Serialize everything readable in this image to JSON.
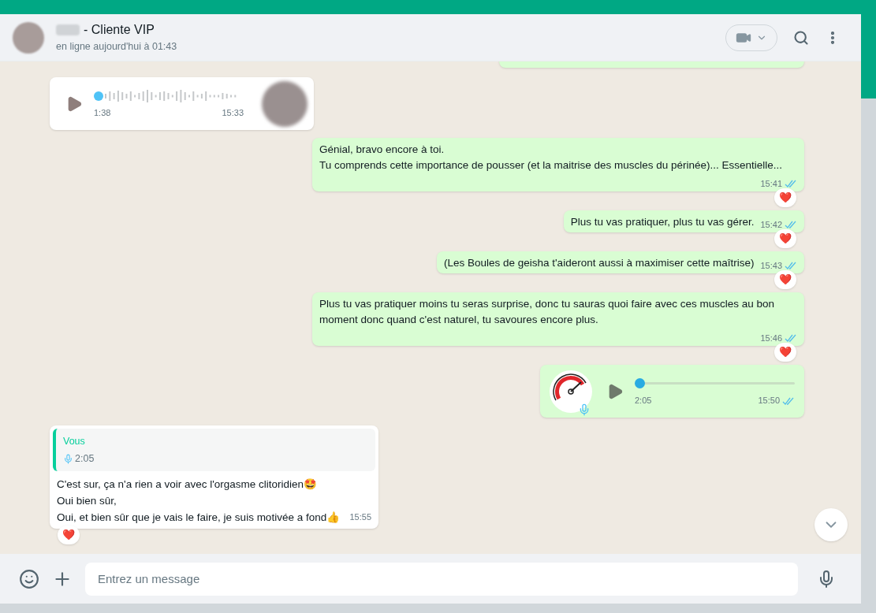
{
  "header": {
    "title": "- Cliente VIP",
    "status": "en ligne aujourd'hui à 01:43"
  },
  "messages": [
    {
      "kind": "partial_out"
    },
    {
      "kind": "voice_in",
      "duration": "1:38",
      "time": "15:33",
      "level": 0
    },
    {
      "kind": "text_out",
      "lines": [
        "Génial, bravo encore à toi.",
        "Tu comprends cette importance de pousser (et la maitrise des muscles du périnée)... Essentielle..."
      ],
      "time": "15:41",
      "read": true,
      "reaction": "❤️"
    },
    {
      "kind": "text_out",
      "lines": [
        "Plus tu vas pratiquer, plus tu vas gérer."
      ],
      "time": "15:42",
      "read": true,
      "reaction": "❤️"
    },
    {
      "kind": "text_out",
      "lines": [
        "(Les Boules de geisha t'aideront aussi à maximiser cette maîtrise)"
      ],
      "time": "15:43",
      "read": true,
      "reaction": "❤️"
    },
    {
      "kind": "text_out",
      "lines": [
        "Plus tu vas pratiquer moins tu seras surprise, donc tu sauras quoi faire avec ces muscles au bon moment donc quand c'est naturel, tu savoures encore plus."
      ],
      "time": "15:46",
      "read": true,
      "reaction": "❤️"
    },
    {
      "kind": "voice_out",
      "duration": "2:05",
      "time": "15:50",
      "read": true,
      "level": 0
    },
    {
      "kind": "reply_in",
      "quote_author": "Vous",
      "quote_duration": "2:05",
      "lines": [
        "C'est sur, ça n'a rien a voir avec l'orgasme clitoridien🤩",
        "Oui bien sûr,",
        "Oui, et bien sûr que je vais le faire, je suis motivée a fond👍"
      ],
      "time": "15:55",
      "reaction": "❤️"
    }
  ],
  "composer": {
    "placeholder": "Entrez un message"
  }
}
